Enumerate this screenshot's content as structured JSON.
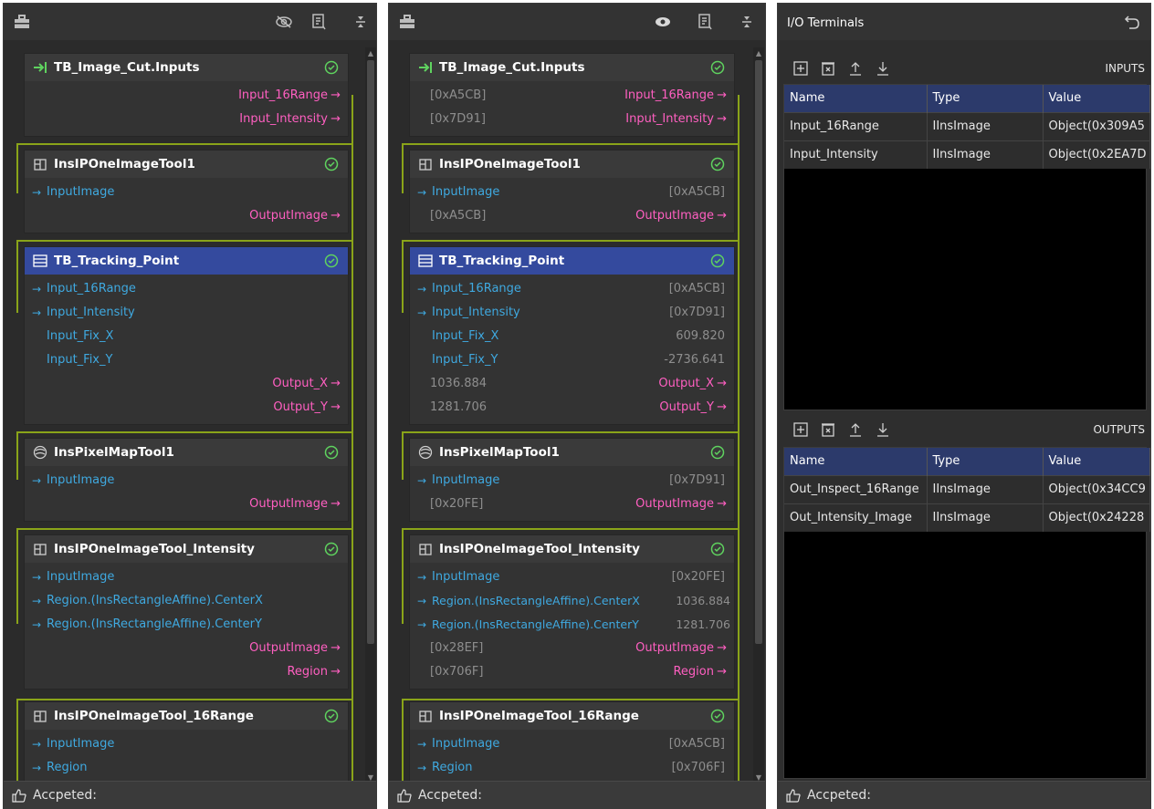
{
  "colors": {
    "panel_bg": "#2b2b2b",
    "node_bg": "#333333",
    "selected_header": "#344a9e",
    "input_port": "#3fa9e0",
    "output_port": "#ff5fc1",
    "wire": "#8aa419",
    "status_ok": "#5fd35f",
    "grid_header": "#2c3a6b"
  },
  "toolbar": {
    "toolbox_icon": "toolbox-icon",
    "left_visibility_icon": "eye-off-icon",
    "mid_visibility_icon": "eye-icon",
    "properties_icon": "properties-icon",
    "collapse_icon": "collapse-icon"
  },
  "status": {
    "label": "Accpeted:"
  },
  "nodes": [
    {
      "title": "TB_Image_Cut.Inputs",
      "icon": "terminal-input-icon",
      "rows": [
        {
          "kind": "out",
          "label": "Input_16Range",
          "mid_left": "[0xA5CB]"
        },
        {
          "kind": "out",
          "label": "Input_Intensity",
          "mid_left": "[0x7D91]"
        }
      ]
    },
    {
      "title": "InsIPOneImageTool1",
      "icon": "image-tool-icon",
      "rows": [
        {
          "kind": "in",
          "label": "InputImage",
          "mid_right": "[0xA5CB]"
        },
        {
          "kind": "out",
          "label": "OutputImage",
          "mid_left": "[0xA5CB]"
        }
      ]
    },
    {
      "title": "TB_Tracking_Point",
      "icon": "list-icon",
      "selected": true,
      "rows": [
        {
          "kind": "in",
          "label": "Input_16Range",
          "mid_right": "[0xA5CB]"
        },
        {
          "kind": "in",
          "label": "Input_Intensity",
          "mid_right": "[0x7D91]"
        },
        {
          "kind": "plain",
          "label": "Input_Fix_X",
          "mid_right": "609.820"
        },
        {
          "kind": "plain",
          "label": "Input_Fix_Y",
          "mid_right": "-2736.641"
        },
        {
          "kind": "out",
          "label": "Output_X",
          "mid_left": "1036.884"
        },
        {
          "kind": "out",
          "label": "Output_Y",
          "mid_left": "1281.706"
        }
      ]
    },
    {
      "title": "InsPixelMapTool1",
      "icon": "pixel-map-icon",
      "rows": [
        {
          "kind": "in",
          "label": "InputImage",
          "mid_right": "[0x7D91]"
        },
        {
          "kind": "out",
          "label": "OutputImage",
          "mid_left": "[0x20FE]"
        }
      ]
    },
    {
      "title": "InsIPOneImageTool_Intensity",
      "icon": "image-tool-icon",
      "rows": [
        {
          "kind": "in",
          "label": "InputImage",
          "mid_right": "[0x20FE]"
        },
        {
          "kind": "in",
          "label": "Region.(InsRectangleAffine).CenterX",
          "mid_right": "1036.884"
        },
        {
          "kind": "in",
          "label": "Region.(InsRectangleAffine).CenterY",
          "mid_right": "1281.706"
        },
        {
          "kind": "out",
          "label": "OutputImage",
          "mid_left": "[0x28EF]"
        },
        {
          "kind": "out",
          "label": "Region",
          "mid_left": "[0x706F]"
        }
      ]
    },
    {
      "title": "InsIPOneImageTool_16Range",
      "icon": "image-tool-icon",
      "rows": [
        {
          "kind": "in",
          "label": "InputImage",
          "mid_right": "[0xA5CB]"
        },
        {
          "kind": "in",
          "label": "Region",
          "mid_right": "[0x706F]"
        }
      ]
    }
  ],
  "io_terminals": {
    "title": "I/O Terminals",
    "undo_icon": "undo-icon",
    "toolbar_icons": [
      "add-icon",
      "delete-icon",
      "move-up-icon",
      "move-down-icon"
    ],
    "inputs": {
      "label": "INPUTS",
      "columns": [
        "Name",
        "Type",
        "Value"
      ],
      "rows": [
        [
          "Input_16Range",
          "IInsImage",
          "Object(0x309A5"
        ],
        [
          "Input_Intensity",
          "IInsImage",
          "Object(0x2EA7D"
        ]
      ]
    },
    "outputs": {
      "label": "OUTPUTS",
      "columns": [
        "Name",
        "Type",
        "Value"
      ],
      "rows": [
        [
          "Out_Inspect_16Range",
          "IInsImage",
          "Object(0x34CC9"
        ],
        [
          "Out_Intensity_Image",
          "IInsImage",
          "Object(0x24228"
        ]
      ]
    }
  }
}
